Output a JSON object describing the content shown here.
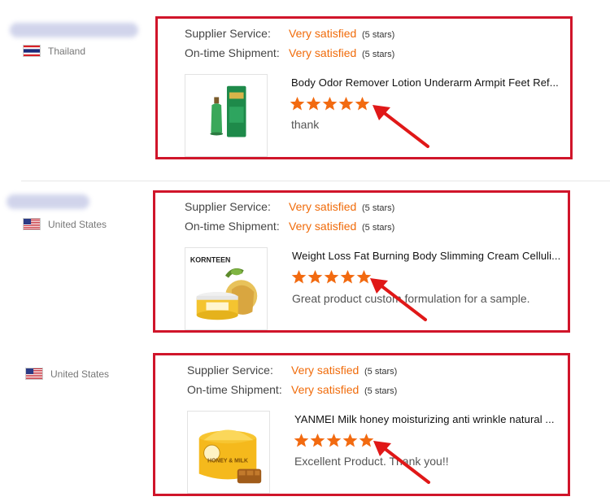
{
  "rating_labels": {
    "supplier": "Supplier Service:",
    "shipment": "On-time Shipment:"
  },
  "colors": {
    "accent_orange": "#f06b0a",
    "highlight_red": "#d0152a",
    "star": "#f26a10"
  },
  "reviews": [
    {
      "country": "Thailand",
      "flag": "thailand-flag",
      "supplier_value": "Very satisfied",
      "supplier_stars": "(5 stars)",
      "shipment_value": "Very satisfied",
      "shipment_stars": "(5 stars)",
      "product_title": "Body Odor Remover Lotion Underarm Armpit Feet Ref...",
      "rating": 5,
      "feedback": "thank"
    },
    {
      "country": "United States",
      "flag": "us-flag",
      "supplier_value": "Very satisfied",
      "supplier_stars": "(5 stars)",
      "shipment_value": "Very satisfied",
      "shipment_stars": "(5 stars)",
      "product_title": "Weight Loss Fat Burning Body Slimming Cream Celluli...",
      "brand_text": "KORNTEEN",
      "rating": 5,
      "feedback": "Great product custom formulation for a sample."
    },
    {
      "country": "United States",
      "flag": "us-flag",
      "supplier_value": "Very satisfied",
      "supplier_stars": "(5 stars)",
      "shipment_value": "Very satisfied",
      "shipment_stars": "(5 stars)",
      "product_title": "YANMEI Milk honey moisturizing anti wrinkle natural ...",
      "jar_text": "HONEY & MILK",
      "rating": 5,
      "feedback": "Excellent Product.  Thank you!!"
    }
  ]
}
